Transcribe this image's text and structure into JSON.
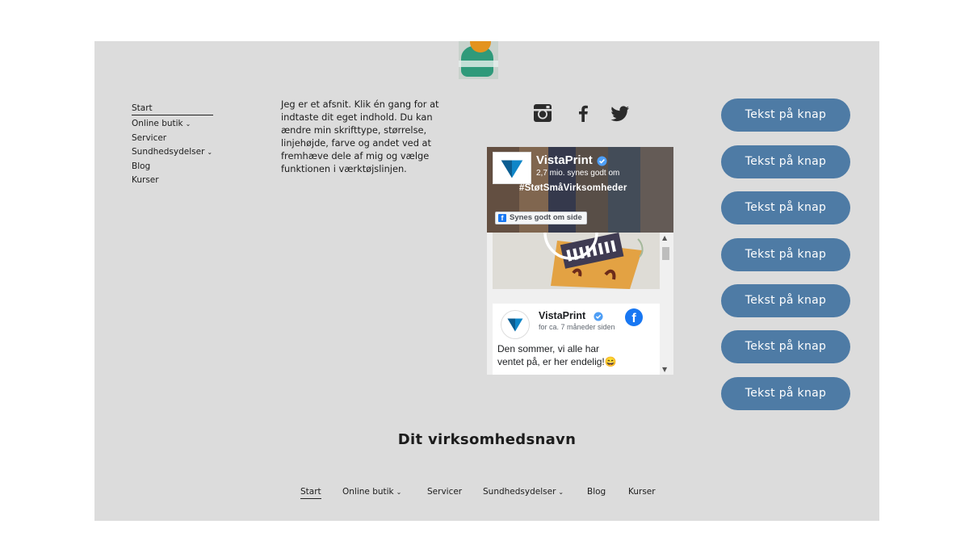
{
  "nav": {
    "items": [
      {
        "label": "Start",
        "active": true,
        "dropdown": false
      },
      {
        "label": "Online butik",
        "active": false,
        "dropdown": true
      },
      {
        "label": "Servicer",
        "active": false,
        "dropdown": false
      },
      {
        "label": "Sundhedsydelser",
        "active": false,
        "dropdown": true
      },
      {
        "label": "Blog",
        "active": false,
        "dropdown": false
      },
      {
        "label": "Kurser",
        "active": false,
        "dropdown": false
      }
    ],
    "chevron": "⌄"
  },
  "paragraph": "Jeg er et afsnit. Klik én gang for at indtaste dit eget indhold. Du kan ændre min skrifttype, størrelse, linjehøjde, farve og andet ved at fremhæve dele af mig og vælge funktionen i værktøjslinjen.",
  "social": {
    "icons": [
      "instagram-icon",
      "facebook-icon",
      "twitter-icon"
    ],
    "color": "#2b2b2b"
  },
  "facebook_widget": {
    "page_name": "VistaPrint",
    "likes": "2,7 mio. synes godt om",
    "cover_tag": "#StøtSmåVirksomheder",
    "like_button": "Synes godt om side",
    "post": {
      "author": "VistaPrint",
      "time": "for ca. 7 måneder siden",
      "text": "Den sommer, vi alle har ventet på, er her endelig!😄"
    },
    "brand_color": "#1877f2"
  },
  "buttons": {
    "label": "Tekst på knap",
    "count": 7,
    "color": "#4e7ba5"
  },
  "business_name": "Dit virksomhedsnavn",
  "footer_nav": {
    "items": [
      {
        "label": "Start",
        "active": true,
        "dropdown": false
      },
      {
        "label": "Online butik",
        "active": false,
        "dropdown": true
      },
      {
        "label": "Servicer",
        "active": false,
        "dropdown": false
      },
      {
        "label": "Sundhedsydelser",
        "active": false,
        "dropdown": true
      },
      {
        "label": "Blog",
        "active": false,
        "dropdown": false
      },
      {
        "label": "Kurser",
        "active": false,
        "dropdown": false
      }
    ]
  },
  "colors": {
    "canvas": "#dcdcdc",
    "text": "#1c1c1c"
  }
}
